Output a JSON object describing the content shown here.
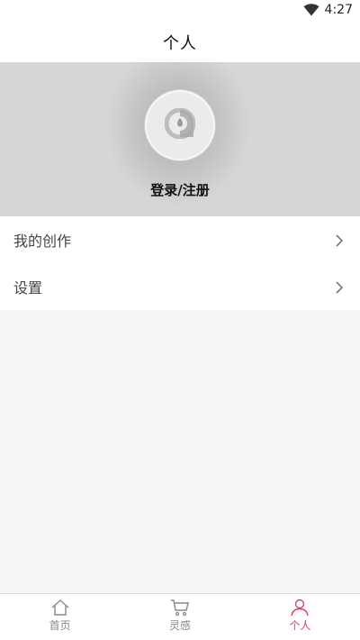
{
  "status_bar": {
    "time": "4:27",
    "wifi_icon": "wifi-icon"
  },
  "header": {
    "title": "个人"
  },
  "profile": {
    "avatar_icon": "avatar-placeholder-icon",
    "login_label": "登录/注册"
  },
  "menu": {
    "items": [
      {
        "label": "我的创作",
        "icon": "chevron-right-icon"
      },
      {
        "label": "设置",
        "icon": "chevron-right-icon"
      }
    ]
  },
  "bottom_nav": {
    "items": [
      {
        "label": "首页",
        "icon": "home-icon",
        "active": false
      },
      {
        "label": "灵感",
        "icon": "cart-icon",
        "active": false
      },
      {
        "label": "个人",
        "icon": "person-icon",
        "active": true
      }
    ],
    "active_color": "#d9445f",
    "inactive_color": "#888888"
  }
}
